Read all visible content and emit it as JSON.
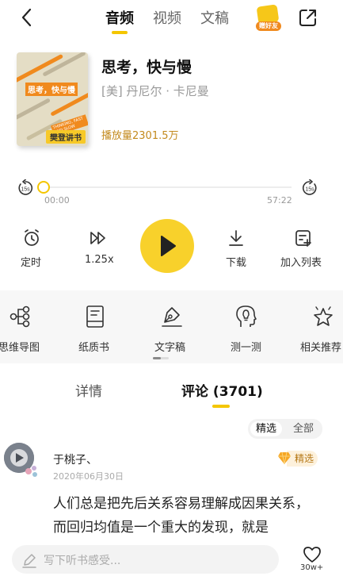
{
  "nav": {
    "tabs": [
      "音频",
      "视频",
      "文稿"
    ],
    "active_tab": "音频",
    "gift_label": "赠好友"
  },
  "book": {
    "cover_title": "思考，快与慢",
    "cover_subtitle": "THINKING, FAST AND SLOW",
    "cover_brand": "樊登讲书",
    "title": "思考，快与慢",
    "author": "[美] 丹尼尔 · 卡尼曼",
    "plays": "播放量2301.5万"
  },
  "player": {
    "rewind_label": "15s",
    "forward_label": "15s",
    "current_time": "00:00",
    "total_time": "57:22",
    "progress": 0
  },
  "controls": {
    "timer": "定时",
    "speed": "1.25x",
    "download": "下载",
    "add_to_list": "加入列表"
  },
  "features": [
    "思维导图",
    "纸质书",
    "文字稿",
    "测一测",
    "相关推荐"
  ],
  "detail_tabs": {
    "details": "详情",
    "comments": "评论 (3701)"
  },
  "comment_filter": {
    "selected": "精选",
    "all": "全部"
  },
  "comment": {
    "user": "于桃子、",
    "date": "2020年06月30日",
    "badge": "精选",
    "text": "人们总是把先后关系容易理解成因果关系，而回归均值是一个重大的发现，就是"
  },
  "bottom": {
    "input_placeholder": "写下听书感受...",
    "like_count": "30w+"
  },
  "colors": {
    "accent": "#f4c600",
    "play_button": "#f8d12b",
    "plays_text": "#c38a1d",
    "badge_bg": "#fdf1dc"
  }
}
